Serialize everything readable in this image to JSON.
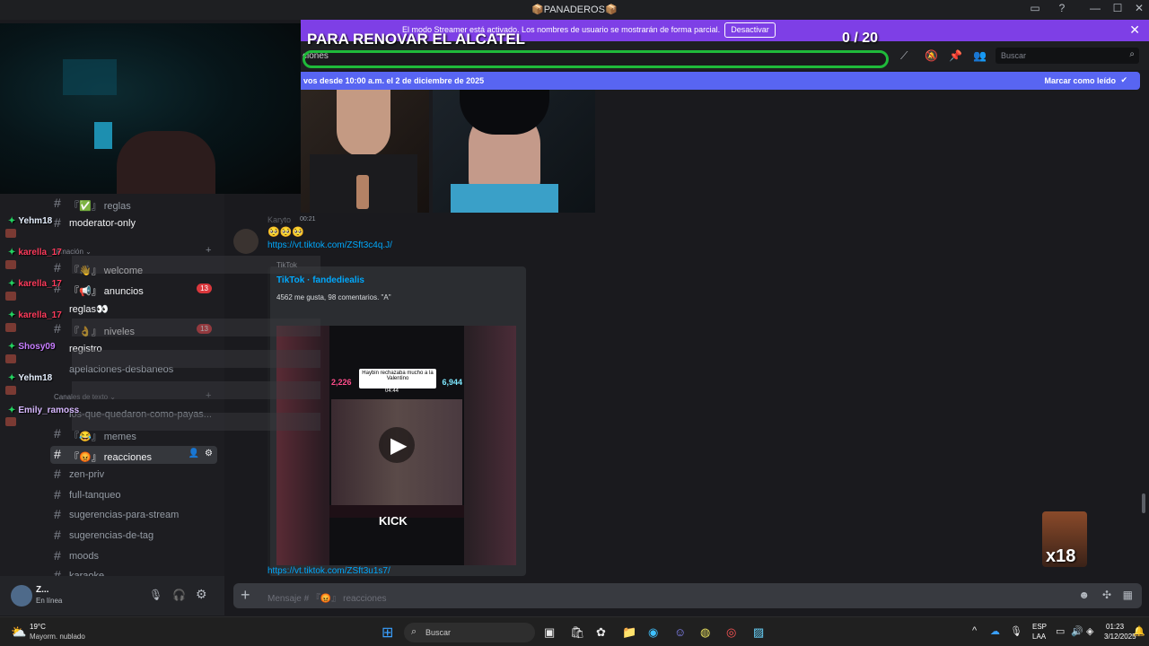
{
  "window": {
    "title": "📦PANADEROS📦",
    "buttons": {
      "inbox": "▭",
      "help": "?",
      "minimize": "—",
      "maximize": "☐",
      "close": "✕"
    }
  },
  "streamer_banner": {
    "message": "El modo Streamer está activado. Los nombres de usuario se mostrarán de forma parcial.",
    "button": "Desactivar",
    "close": "✕"
  },
  "overlay": {
    "title": "PARA RENOVAR EL ALCATEL",
    "count": "0  / 20"
  },
  "header": {
    "channel_partial": "ciones",
    "search_placeholder": "Buscar",
    "icons": [
      "threads-icon",
      "mute-icon",
      "pin-icon",
      "members-icon"
    ]
  },
  "new_messages": {
    "text": "vos desde 10:00 a.m. el 2 de diciembre de 2025",
    "mark": "Marcar como leído"
  },
  "message": {
    "author": "Karyto",
    "time": "00:21",
    "emojis": "🥺🥺🥺",
    "link": "https://vt.tiktok.com/ZSft3c4q.J/",
    "link2": "https://vt.tiktok.com/ZSft3u1s7/"
  },
  "embed": {
    "provider": "TikTok",
    "title": "TikTok · fandediealis",
    "desc": "4562 me gusta, 98 comentarios. \"A\"",
    "caption": "Haybin rechazaba mucho a la Valentino",
    "left_count": "2,226",
    "right_count": "6,944",
    "timer": "04:44",
    "bottom_text": "KICK"
  },
  "sidebar": {
    "channels": [
      {
        "label": "reglas",
        "prefix": "『✅』"
      },
      {
        "label": "moderator-only",
        "prefix": ""
      },
      {
        "label": "welcome",
        "prefix": "『👋』"
      },
      {
        "label": "anuncios",
        "prefix": "『📢』",
        "badge": "13"
      },
      {
        "label": "reglas👀",
        "prefix": ""
      },
      {
        "label": "niveles",
        "prefix": "『👌』",
        "badge": "13"
      },
      {
        "label": "registro",
        "prefix": ""
      },
      {
        "label": "apelaciones-desbaneos",
        "prefix": ""
      },
      {
        "label": "los-que-quedaron-como-payas...",
        "prefix": ""
      },
      {
        "label": "memes",
        "prefix": "『😂』"
      },
      {
        "label": "reacciones",
        "prefix": "『😡』"
      },
      {
        "label": "zen-priv",
        "prefix": ""
      },
      {
        "label": "full-tanqueo",
        "prefix": ""
      },
      {
        "label": "sugerencias-para-stream",
        "prefix": ""
      },
      {
        "label": "sugerencias-de-tag",
        "prefix": ""
      },
      {
        "label": "moods",
        "prefix": ""
      },
      {
        "label": "karaoke",
        "prefix": ""
      }
    ],
    "categories": {
      "info": "ormación",
      "text": "Canales de texto"
    }
  },
  "stream_chat": [
    {
      "name": "Yehm18",
      "color": "#e6f0ff"
    },
    {
      "name": "karella_17",
      "color": "#ff3b5c"
    },
    {
      "name": "karella_17",
      "color": "#ff3b5c"
    },
    {
      "name": "karella_17",
      "color": "#ff3b5c"
    },
    {
      "name": "Shosy09",
      "color": "#c77dff"
    },
    {
      "name": "Yehm18",
      "color": "#e6f0ff"
    },
    {
      "name": "Emily_ramoss",
      "color": "#d7b8ff"
    }
  ],
  "user_panel": {
    "name": "Z...",
    "status": "En línea"
  },
  "input": {
    "placeholder": "Mensaje # 『😡』 reacciones"
  },
  "sticker": {
    "label": "x18"
  },
  "taskbar": {
    "weather_temp": "19°C",
    "weather_desc": "Mayorm. nublado",
    "search": "Buscar",
    "lang1": "ESP",
    "lang2": "LAA",
    "time": "01:23",
    "date": "3/12/2025"
  }
}
